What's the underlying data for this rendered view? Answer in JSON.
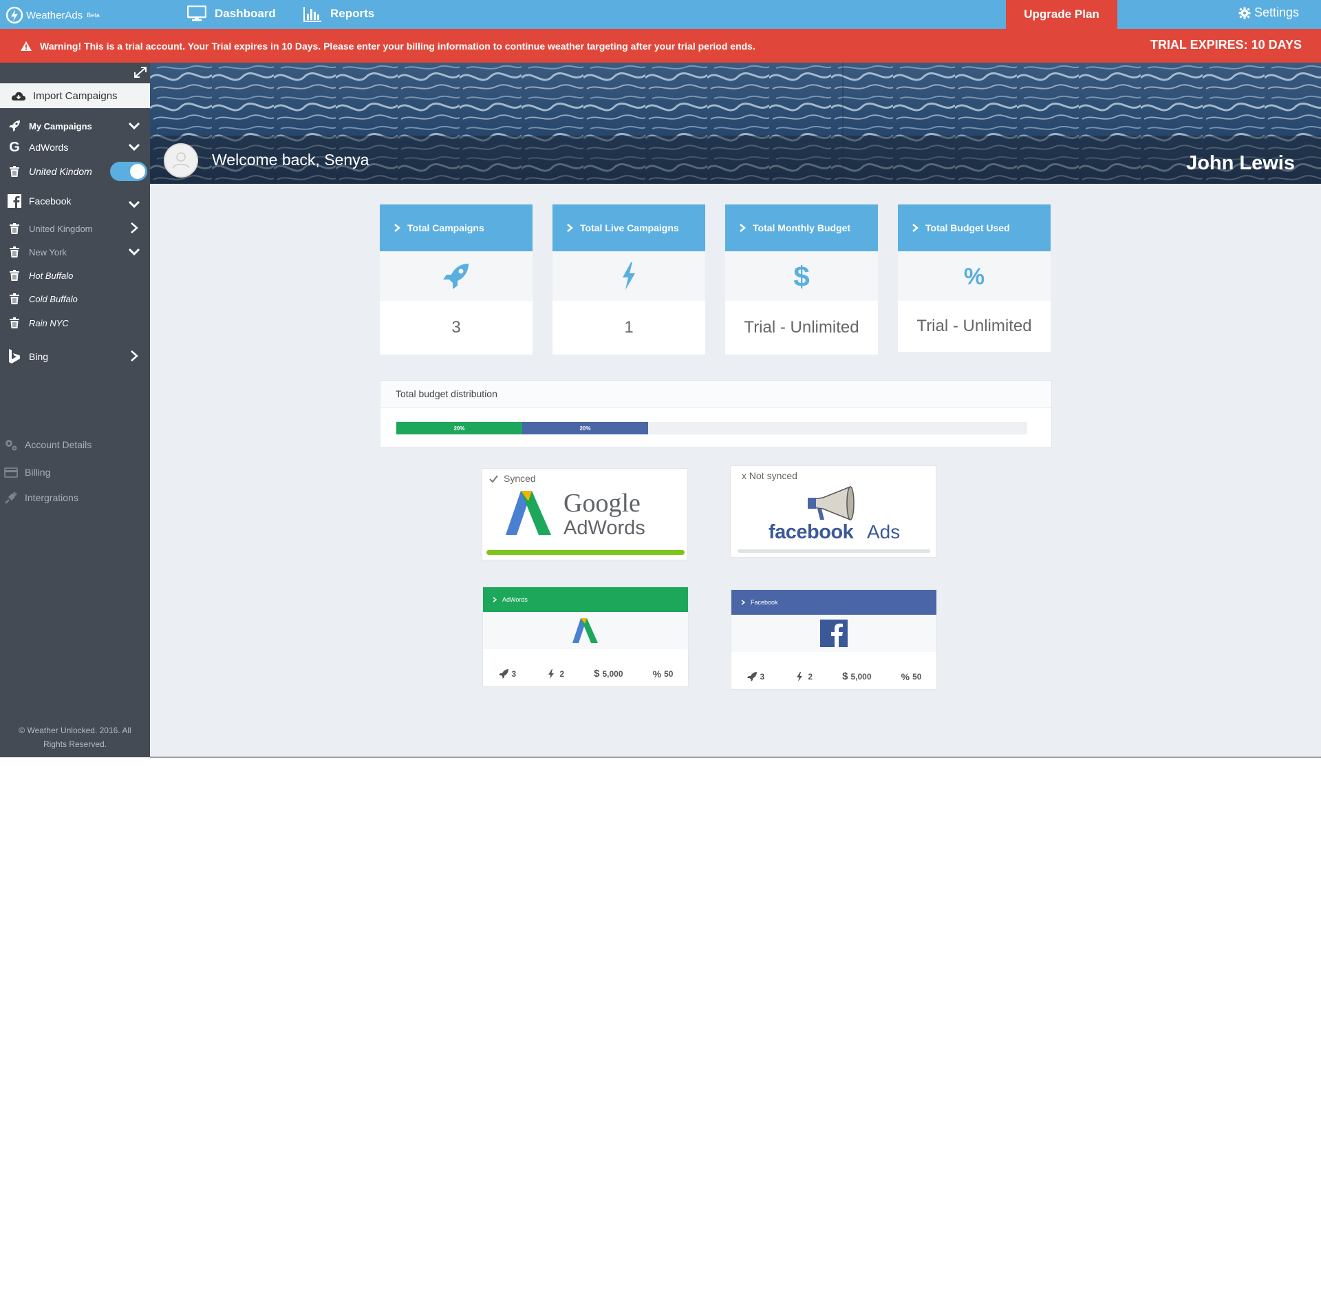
{
  "app": {
    "name": "WeatherAds",
    "badge": "Beta"
  },
  "nav": {
    "dashboard": "Dashboard",
    "reports": "Reports",
    "upgrade": "Upgrade Plan",
    "settings": "Settings"
  },
  "warning": {
    "message": "Warning! This is a trial account. Your Trial expires in 10 Days. Please enter your billing information to continue weather targeting after your trial period ends.",
    "expires": "TRIAL EXPIRES: 10 DAYS"
  },
  "sidebar": {
    "import": "Import Campaigns",
    "my_campaigns": "My Campaigns",
    "adwords": "AdWords",
    "adwords_uk": "United Kindom",
    "facebook": "Facebook",
    "fb_uk": "United Kingdom",
    "fb_ny": "New York",
    "hot_buffalo": "Hot Buffalo",
    "cold_buffalo": "Cold Buffalo",
    "rain_nyc": "Rain NYC",
    "bing": "Bing",
    "account": "Account Details",
    "billing": "Billing",
    "integrations": "Intergrations",
    "copyright_1": "© Weather Unlocked. 2016. All",
    "copyright_2": "Rights Reserved."
  },
  "hero": {
    "welcome": "Welcome back, Senya",
    "client": "John Lewis"
  },
  "stats": [
    {
      "label": "Total Campaigns",
      "value": "3"
    },
    {
      "label": "Total Live Campaigns",
      "value": "1"
    },
    {
      "label": "Total Monthly Budget",
      "value": "Trial - Unlimited"
    },
    {
      "label": "Total Budget Used",
      "value": "Trial - Unlimited"
    }
  ],
  "budget": {
    "title": "Total budget distribution",
    "segments": [
      {
        "label": "20%",
        "value": 0.2,
        "color": "#1ca75b"
      },
      {
        "label": "20%",
        "value": 0.2,
        "color": "#4a66a6"
      }
    ]
  },
  "sync": {
    "adwords": {
      "status": "Synced",
      "brand_1": "Google",
      "brand_2": "AdWords",
      "progress": 1.0
    },
    "facebook": {
      "status": "x Not synced",
      "brand_1": "facebook",
      "brand_2": "Ads",
      "progress": 0.0
    }
  },
  "platforms": [
    {
      "name": "AdWords",
      "color": "#1ca75b",
      "campaigns": "3",
      "live": "2",
      "budget": "5,000",
      "used": "50"
    },
    {
      "name": "Facebook",
      "color": "#4a66a6",
      "campaigns": "3",
      "live": "2",
      "budget": "5,000",
      "used": "50"
    }
  ],
  "colors": {
    "primary": "#5aaee0",
    "alert": "#e0473a",
    "sidebar": "#444b55",
    "adwords_green": "#1ca75b",
    "facebook_blue": "#4a66a6"
  }
}
